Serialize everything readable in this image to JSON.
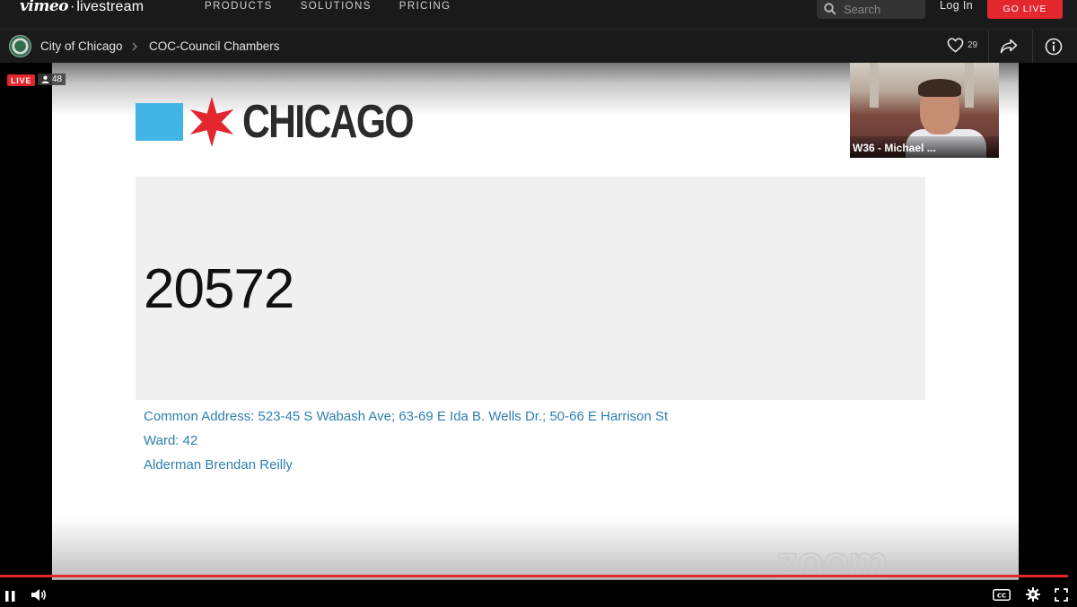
{
  "nav": {
    "logo_brand": "vimeo",
    "logo_separator": "·",
    "logo_product": "livestream",
    "links": [
      "PRODUCTS",
      "SOLUTIONS",
      "PRICING"
    ],
    "search_placeholder": "Search",
    "login_label": "Log In",
    "golive_label": "GO LIVE"
  },
  "breadcrumb": {
    "channel": "City of Chicago",
    "event": "COC-Council Chambers"
  },
  "actions": {
    "like_count": "29"
  },
  "player": {
    "live_label": "LIVE",
    "viewer_count": "48",
    "progress": 0.992
  },
  "slide": {
    "logo_text": "CHICAGO",
    "record_number": "20572",
    "address_line": "Common Address:  523-45 S Wabash Ave; 63-69 E Ida B. Wells Dr.; 50-66 E Harrison St",
    "ward_line": "Ward: 42",
    "alderman_line": "Alderman Brendan Reilly",
    "watermark": "zoom"
  },
  "pip": {
    "caption": "W36 - Michael ..."
  },
  "colors": {
    "accent_red": "#e4262e",
    "chicago_blue": "#41b6e6",
    "address_blue": "#2f7fb0"
  }
}
